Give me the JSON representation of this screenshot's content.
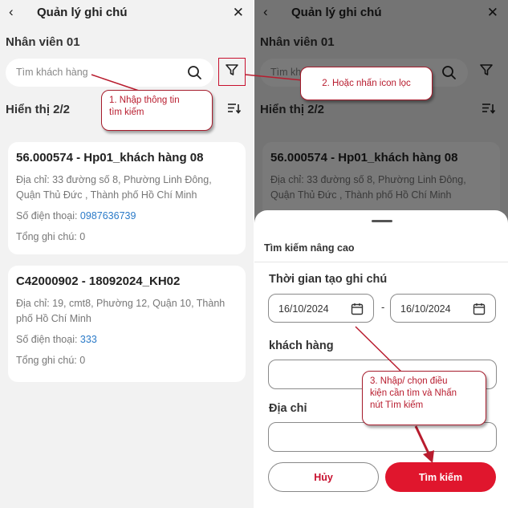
{
  "header": {
    "title": "Quản lý ghi chú"
  },
  "staff_name": "Nhân viên 01",
  "search": {
    "placeholder": "Tìm khách hàng"
  },
  "count_label": "Hiển thị 2/2",
  "customers": [
    {
      "title": "56.000574 - Hp01_khách hàng 08",
      "address_lines": [
        "Địa chỉ: 33 đường số 8, Phường Linh Đông,",
        "Quận Thủ Đức , Thành phố Hồ Chí Minh"
      ],
      "phone_label": "Số điện thoại: ",
      "phone": "0987636739",
      "notes": "Tổng ghi chú: 0"
    },
    {
      "title": "C42000902 - 18092024_KH02",
      "address_lines": [
        "Địa chỉ: 19, cmt8, Phường 12, Quận 10, Thành",
        "phố Hồ Chí Minh"
      ],
      "phone_label": "Số điện thoại: ",
      "phone": "333",
      "notes": "Tổng ghi chú: 0"
    }
  ],
  "advanced_search": {
    "title": "Tìm kiếm nâng cao",
    "created_time_label": "Thời gian tạo ghi chú",
    "date_from": "16/10/2024",
    "date_to": "16/10/2024",
    "date_separator": "-",
    "customer_label": "khách hàng",
    "address_label": "Địa chỉ",
    "cancel_label": "Hủy",
    "submit_label": "Tìm kiếm"
  },
  "callouts": {
    "step1": [
      "1. Nhập thông tin",
      "tìm kiếm"
    ],
    "step2": "2. Hoặc nhấn icon lọc",
    "step3": [
      "3. Nhập/ chọn điều",
      "kiện cần tìm và Nhấn",
      "nút Tìm kiếm"
    ]
  },
  "colors": {
    "accent": "#e0162d",
    "link": "#2a7ac8",
    "callout_border": "#a61c2c"
  },
  "icons": [
    "back-arrow-icon",
    "close-icon",
    "search-icon",
    "filter-icon",
    "sort-icon",
    "calendar-icon"
  ]
}
